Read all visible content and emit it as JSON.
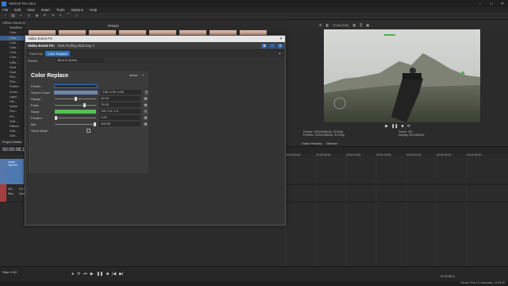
{
  "app": {
    "title": "VEGAS Pro 19.0",
    "window_controls": [
      "–",
      "□",
      "✕"
    ]
  },
  "menu": [
    "File",
    "Edit",
    "View",
    "Insert",
    "Tools",
    "Options",
    "Help"
  ],
  "explorer": {
    "folder": "HitFilm Movie Essentials Pack",
    "items": [
      "NewBlue",
      "Colo...",
      "Colo...",
      "Colo...",
      "Colo...",
      "Colo...",
      "Colo...",
      "Diffu...",
      "Dust",
      "Dust",
      "Film...",
      "Film...",
      "Frame",
      "Grad...",
      "Light...",
      "Del...",
      "Noise",
      "Pen...",
      "Pix...",
      "Soft...",
      "Stereo",
      "Sub...",
      "Sub..."
    ]
  },
  "preset_label": "Preset:",
  "dialog": {
    "title": "Video Event FX",
    "close": "✕",
    "fx_header_bold": "Video Event FX:",
    "fx_header_clip": "Tank Rolling Bad Day 2",
    "chain_tabs": [
      "Pan/Crop",
      "Color Replace"
    ],
    "chain_active": 1,
    "preset_label": "Preset:",
    "preset_value": "Blue to Green",
    "plugin": {
      "name": "Color Replace",
      "about": "About",
      "help": "?",
      "preset_label": "Preset:",
      "params": [
        {
          "label": "Source Color:",
          "value": "236, 0.20, 0.60",
          "kind": "swatch-src"
        },
        {
          "label": "Range:",
          "value": "30.00",
          "kind": "slider",
          "level": 0.5
        },
        {
          "label": "Fade:",
          "value": "75.00",
          "kind": "slider",
          "level": 0.72
        },
        {
          "label": "Swap:",
          "value": "120, 0.5, 1.0",
          "kind": "swatch-sw"
        },
        {
          "label": "Feather:",
          "value": "0.00",
          "kind": "slider",
          "level": 0.0
        },
        {
          "label": "Mix:",
          "value": "100.00",
          "kind": "slider",
          "level": 0.97
        },
        {
          "label": "Show Mask:",
          "value": "",
          "kind": "checkbox"
        }
      ]
    }
  },
  "preview": {
    "quality": "Good (Full)",
    "info_left": [
      "Project: 1920x1080x32, 30.000p",
      "Preview: 1920x1080x32, 30.000p",
      "Video Preview"
    ],
    "info_right": [
      "Frame: 251",
      "Display: 597x336x32"
    ],
    "tabs": [
      "Video Preview",
      "Trimmer"
    ]
  },
  "project_media": "Project Media",
  "timeline": {
    "timecode": "00:00:08;11",
    "ruler": [
      "00:00:00;00",
      "00:00:05;00",
      "00:00:10;00",
      "00:00:15;00",
      "00:00:20;00",
      "00:00:25;00",
      "00:00:30;00",
      "00:00:35;00"
    ],
    "track1_clip": "Level: 100.0%",
    "track2_labels": [
      "Vol:",
      "Pan:"
    ],
    "track2_values": [
      "0.0 dB",
      "Center"
    ],
    "rate": "Rate: 0.00",
    "end_time": "00:00:08;11",
    "record_time": "Record Time (2 channels): 14:05:30"
  }
}
